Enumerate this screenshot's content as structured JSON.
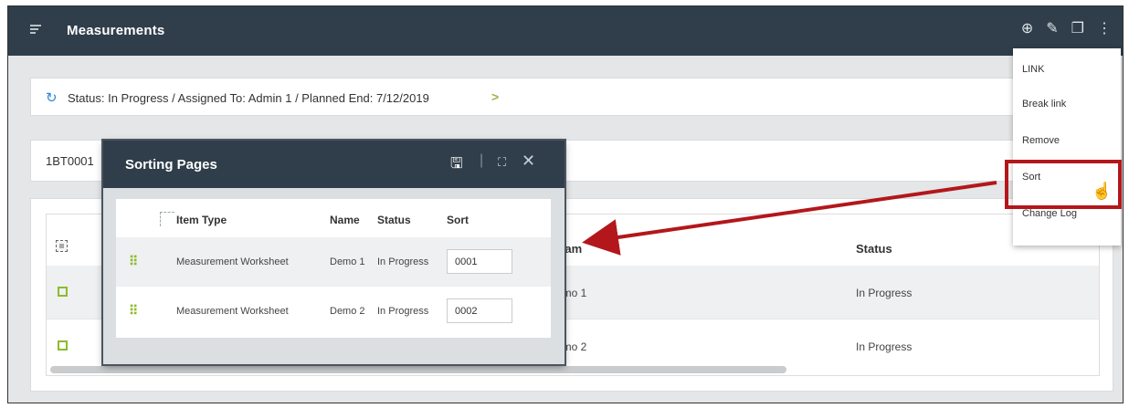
{
  "app": {
    "title": "Measurements"
  },
  "toolbar": {
    "icons": [
      "add-icon",
      "edit-icon",
      "copy-icon",
      "more-icon"
    ]
  },
  "status": {
    "text": "Status: In Progress / Assigned To: Admin 1 / Planned End: 7/12/2019",
    "chevron": ">"
  },
  "record": {
    "id": "1BT0001"
  },
  "table": {
    "headers": {
      "name": "Nam",
      "status": "Status"
    },
    "rows": [
      {
        "name": "emo 1",
        "status": "In Progress"
      },
      {
        "name": "emo 2",
        "status": "In Progress"
      }
    ]
  },
  "menu": {
    "items": [
      {
        "label": "LINK"
      },
      {
        "label": "Break link"
      },
      {
        "label": "Remove"
      },
      {
        "label": "Sort"
      },
      {
        "label": "Change Log"
      }
    ]
  },
  "modal": {
    "title": "Sorting Pages",
    "columns": {
      "item_type": "Item Type",
      "name": "Name",
      "status": "Status",
      "sort": "Sort"
    },
    "rows": [
      {
        "item_type": "Measurement Worksheet",
        "name": "Demo 1",
        "status": "In Progress",
        "sort": "0001"
      },
      {
        "item_type": "Measurement Worksheet",
        "name": "Demo 2",
        "status": "In Progress",
        "sort": "0002"
      }
    ]
  },
  "colors": {
    "header": "#2f3e4a",
    "accent": "#8dbb2c",
    "highlight": "#b3171b"
  }
}
